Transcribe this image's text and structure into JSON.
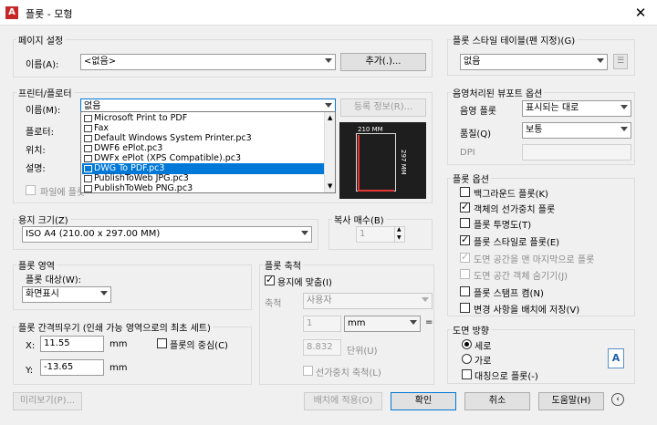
{
  "title": "플롯 - 모형",
  "page_setup": {
    "group": "페이지 설정",
    "name_label": "이름(A):",
    "name_value": "<없음>",
    "add_button": "추가(.)..."
  },
  "printer": {
    "group": "프린터/플로터",
    "name_label": "이름(M):",
    "selected": "없음",
    "props_button": "등록 정보(R)...",
    "plotter_label": "플로터:",
    "where_label": "위치:",
    "desc_label": "설명:",
    "plot_to_file": "파일에 플롯",
    "preview_width": "210 MM",
    "preview_height": "297 MM",
    "options": [
      "Microsoft Print to PDF",
      "Fax",
      "Default Windows System Printer.pc3",
      "DWF6 ePlot.pc3",
      "DWFx ePlot (XPS Compatible).pc3",
      "DWG To PDF.pc3",
      "PublishToWeb JPG.pc3",
      "PublishToWeb PNG.pc3"
    ]
  },
  "paper": {
    "group": "용지 크기(Z)",
    "value": "ISO A4 (210.00 x 297.00 MM)"
  },
  "copies": {
    "group": "복사 매수(B)",
    "value": "1"
  },
  "plot_area": {
    "group": "플롯 영역",
    "what_label": "플롯 대상(W):",
    "value": "화면표시"
  },
  "plot_offset": {
    "group": "플롯 간격띄우기 (인쇄 가능 영역으로의 최초 세트)",
    "x_label": "X:",
    "x_value": "11.55",
    "y_label": "Y:",
    "y_value": "-13.65",
    "unit_x": "mm",
    "unit_y": "mm",
    "center": "플롯의 중심(C)"
  },
  "plot_scale": {
    "group": "플롯 축척",
    "fit": "용지에 맞춤(I)",
    "scale_label": "축척",
    "scale_value": "사용자",
    "val1": "1",
    "unit1": "mm",
    "eq": "=",
    "val2": "8.832",
    "unit2": "단위(U)",
    "lineweights": "선가중치 축척(L)"
  },
  "style_table": {
    "group": "플롯 스타일 테이블(펜 지정)(G)",
    "value": "없음"
  },
  "shaded": {
    "group": "음영처리된 뷰포트 옵션",
    "shade_label": "음영 플롯",
    "shade_value": "표시되는 대로",
    "quality_label": "품질(Q)",
    "quality_value": "보통",
    "dpi_label": "DPI"
  },
  "options": {
    "group": "플롯 옵션",
    "items": [
      {
        "label": "백그라운드 플롯(K)",
        "checked": false,
        "enabled": true
      },
      {
        "label": "객체의 선가중치 플롯",
        "checked": true,
        "enabled": true
      },
      {
        "label": "플롯 투명도(T)",
        "checked": false,
        "enabled": true
      },
      {
        "label": "플롯 스타일로 플롯(E)",
        "checked": true,
        "enabled": true
      },
      {
        "label": "도면 공간을 맨 마지막으로 플롯",
        "checked": true,
        "enabled": false
      },
      {
        "label": "도면 공간 객체 숨기기(J)",
        "checked": false,
        "enabled": false
      },
      {
        "label": "플롯 스탬프 켬(N)",
        "checked": false,
        "enabled": true
      },
      {
        "label": "변경 사항을 배치에 저장(V)",
        "checked": false,
        "enabled": true
      }
    ]
  },
  "orientation": {
    "group": "도면 방향",
    "portrait": "세로",
    "landscape": "가로",
    "upside": "대칭으로 플롯(-)",
    "icon_letter": "A"
  },
  "buttons": {
    "preview": "미리보기(P)...",
    "apply": "배치에 적용(O)",
    "ok": "확인",
    "cancel": "취소",
    "help": "도움말(H)"
  }
}
